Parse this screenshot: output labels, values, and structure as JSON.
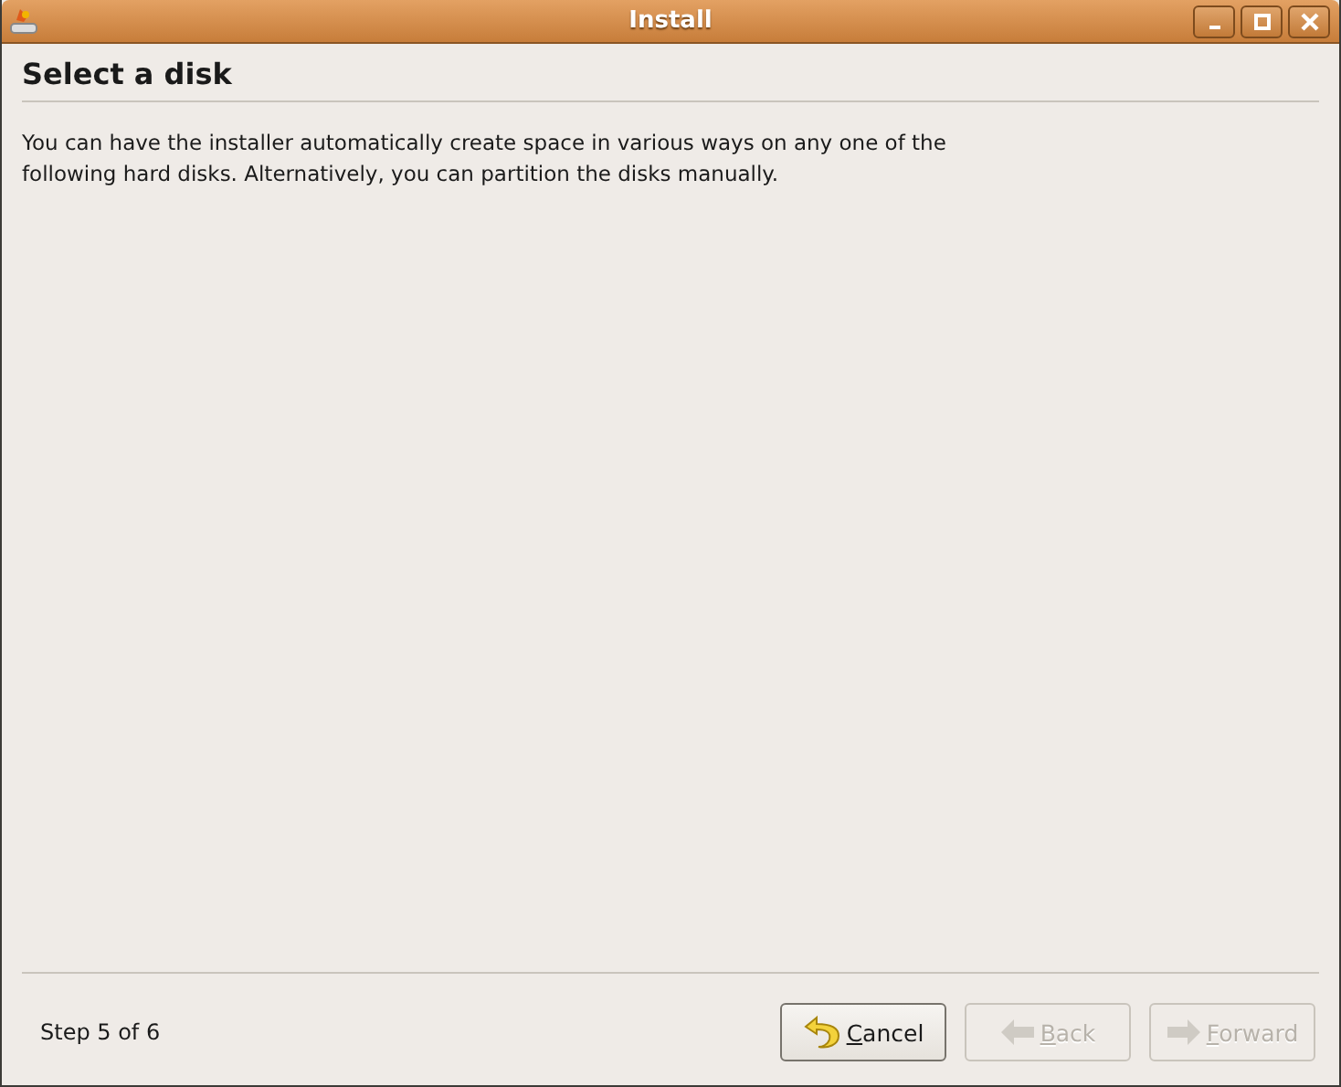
{
  "window": {
    "title": "Install"
  },
  "heading": "Select a disk",
  "description": "You can have the installer automatically create space in various ways on any one of the following hard disks. Alternatively, you can partition the disks manually.",
  "step": "Step 5 of 6",
  "buttons": [
    {
      "kind": "cancel",
      "label": "Cancel",
      "disabled": false
    },
    {
      "kind": "back",
      "label": "Back",
      "disabled": true
    },
    {
      "kind": "forward",
      "label": "Forward",
      "disabled": true
    }
  ]
}
